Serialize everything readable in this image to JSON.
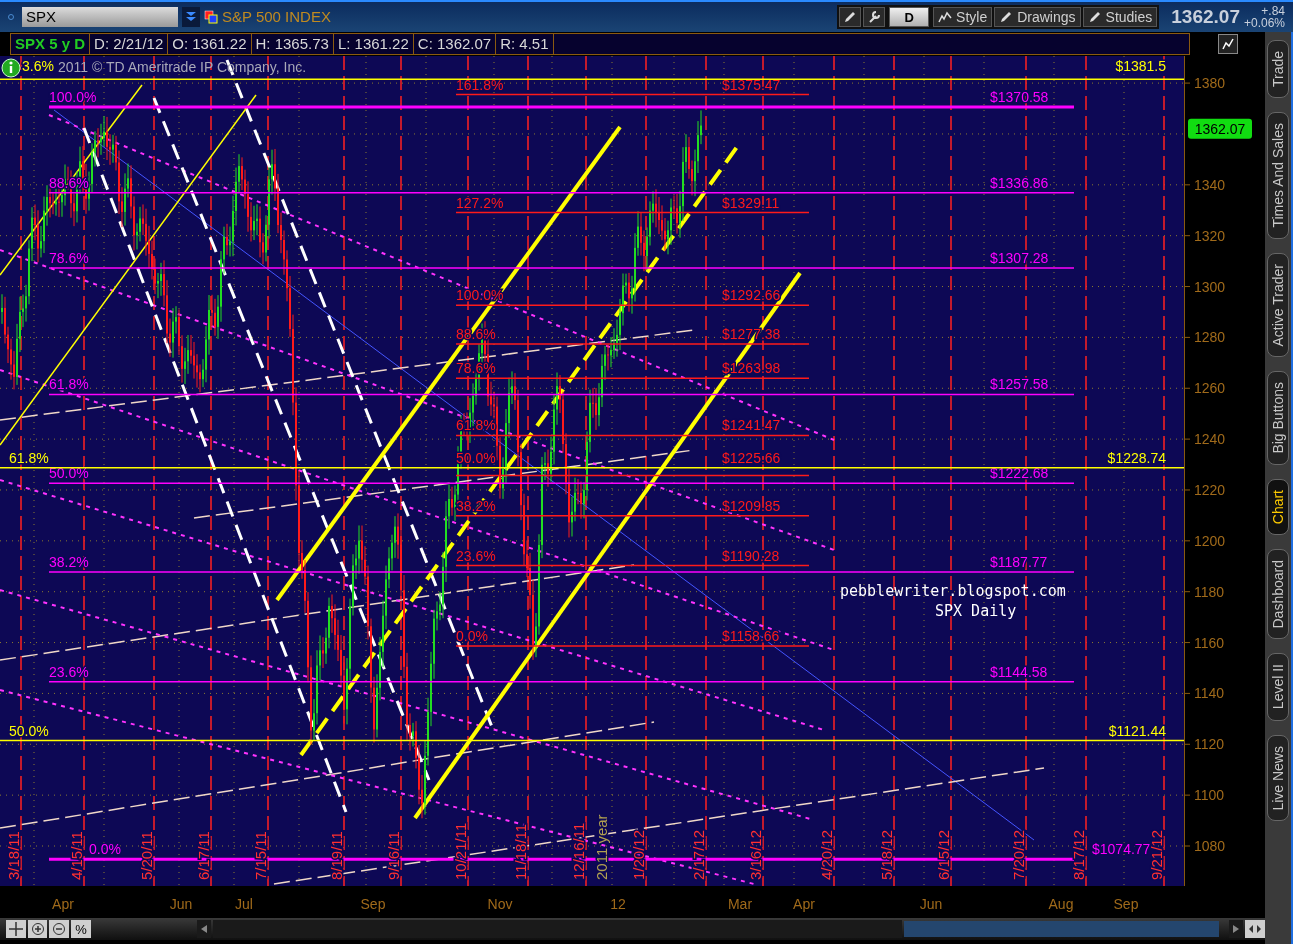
{
  "symbol_bar": {
    "symbol": "SPX",
    "description": "S&P 500 INDEX"
  },
  "toolbar": {
    "aggregation": "D",
    "buttons": [
      "Style",
      "Drawings",
      "Studies"
    ],
    "last_price": "1362.07",
    "change": "+.84",
    "change_percent": "+0.06%"
  },
  "info_row": [
    "SPX 5 y D",
    "D: 2/21/12",
    "O: 1361.22",
    "H: 1365.73",
    "L: 1361.22",
    "C: 1362.07",
    "R: 4.51"
  ],
  "chart": {
    "copyright": "2011 © TD Ameritrade IP Company, Inc.",
    "fib_sets": [
      {
        "kind": "long",
        "color": "#ff00ff",
        "levels": [
          {
            "percent": "100.0%",
            "price": "$1370.58"
          },
          {
            "percent": "88.6%",
            "price": "$1336.86"
          },
          {
            "percent": "78.6%",
            "price": "$1307.28"
          },
          {
            "percent": "61.8%",
            "price": "$1257.58"
          },
          {
            "percent": "50.0%",
            "price": "$1222.68"
          },
          {
            "percent": "38.2%",
            "price": "$1187.77"
          },
          {
            "percent": "23.6%",
            "price": "$1144.58"
          },
          {
            "percent": "0.0%",
            "price": "$1074.77"
          }
        ]
      },
      {
        "kind": "short",
        "color": "#ff1a1a",
        "levels": [
          {
            "percent": "161.8%",
            "price": "$1375.47"
          },
          {
            "percent": "127.2%",
            "price": "$1329.11"
          },
          {
            "percent": "100.0%",
            "price": "$1292.66"
          },
          {
            "percent": "88.6%",
            "price": "$1277.38"
          },
          {
            "percent": "78.6%",
            "price": "$1263.98"
          },
          {
            "percent": "61.8%",
            "price": "$1241.47"
          },
          {
            "percent": "50.0%",
            "price": "$1225.66"
          },
          {
            "percent": "38.2%",
            "price": "$1209.85"
          },
          {
            "percent": "23.6%",
            "price": "$1190.28"
          },
          {
            "percent": "0.0%",
            "price": "$1158.66"
          }
        ]
      },
      {
        "kind": "full",
        "color": "#ffff00",
        "levels": [
          {
            "percent": "3.6%",
            "price": "$1381.5"
          },
          {
            "percent": "61.8%",
            "price": "$1228.74"
          },
          {
            "percent": "50.0%",
            "price": "$1121.44"
          }
        ]
      }
    ],
    "annotations": [
      "pebblewriter.blogspot.com",
      "SPX Daily"
    ],
    "price_ticks": [
      "1380",
      "1340",
      "1320",
      "1300",
      "1280",
      "1260",
      "1240",
      "1220",
      "1200",
      "1180",
      "1160",
      "1140",
      "1120",
      "1100",
      "1080"
    ],
    "last_price_tag": "1362.07",
    "date_markers": [
      {
        "label": "3/18/11",
        "kind": "date"
      },
      {
        "label": "4/15/11",
        "kind": "date"
      },
      {
        "label": "5/20/11",
        "kind": "date"
      },
      {
        "label": "6/17/11",
        "kind": "date"
      },
      {
        "label": "7/15/11",
        "kind": "date"
      },
      {
        "label": "8/19/11",
        "kind": "date"
      },
      {
        "label": "9/16/11",
        "kind": "date"
      },
      {
        "label": "10/21/11",
        "kind": "date"
      },
      {
        "label": "11/18/11",
        "kind": "date"
      },
      {
        "label": "12/16/11",
        "kind": "date"
      },
      {
        "label": "2011 year",
        "kind": "year"
      },
      {
        "label": "1/20/12",
        "kind": "date"
      },
      {
        "label": "2/17/12",
        "kind": "date"
      },
      {
        "label": "3/16/12",
        "kind": "date"
      },
      {
        "label": "4/20/12",
        "kind": "date"
      },
      {
        "label": "5/18/12",
        "kind": "date"
      },
      {
        "label": "6/15/12",
        "kind": "date"
      },
      {
        "label": "7/20/12",
        "kind": "date"
      },
      {
        "label": "8/17/12",
        "kind": "date"
      },
      {
        "label": "9/21/12",
        "kind": "date"
      }
    ],
    "month_labels": [
      "Apr",
      "Jun",
      "Jul",
      "Sep",
      "Nov",
      "12",
      "Mar",
      "Apr",
      "Jun",
      "Aug",
      "Sep"
    ]
  },
  "side_tabs": [
    {
      "label": "Trade",
      "selected": false
    },
    {
      "label": "Times And Sales",
      "selected": false
    },
    {
      "label": "Active Trader",
      "selected": false
    },
    {
      "label": "Big Buttons",
      "selected": false
    },
    {
      "label": "Chart",
      "selected": true
    },
    {
      "label": "Dashboard",
      "selected": false
    },
    {
      "label": "Level II",
      "selected": false
    },
    {
      "label": "Live News",
      "selected": false
    }
  ],
  "bottom_toolbar": {
    "percent_button": "%"
  }
}
